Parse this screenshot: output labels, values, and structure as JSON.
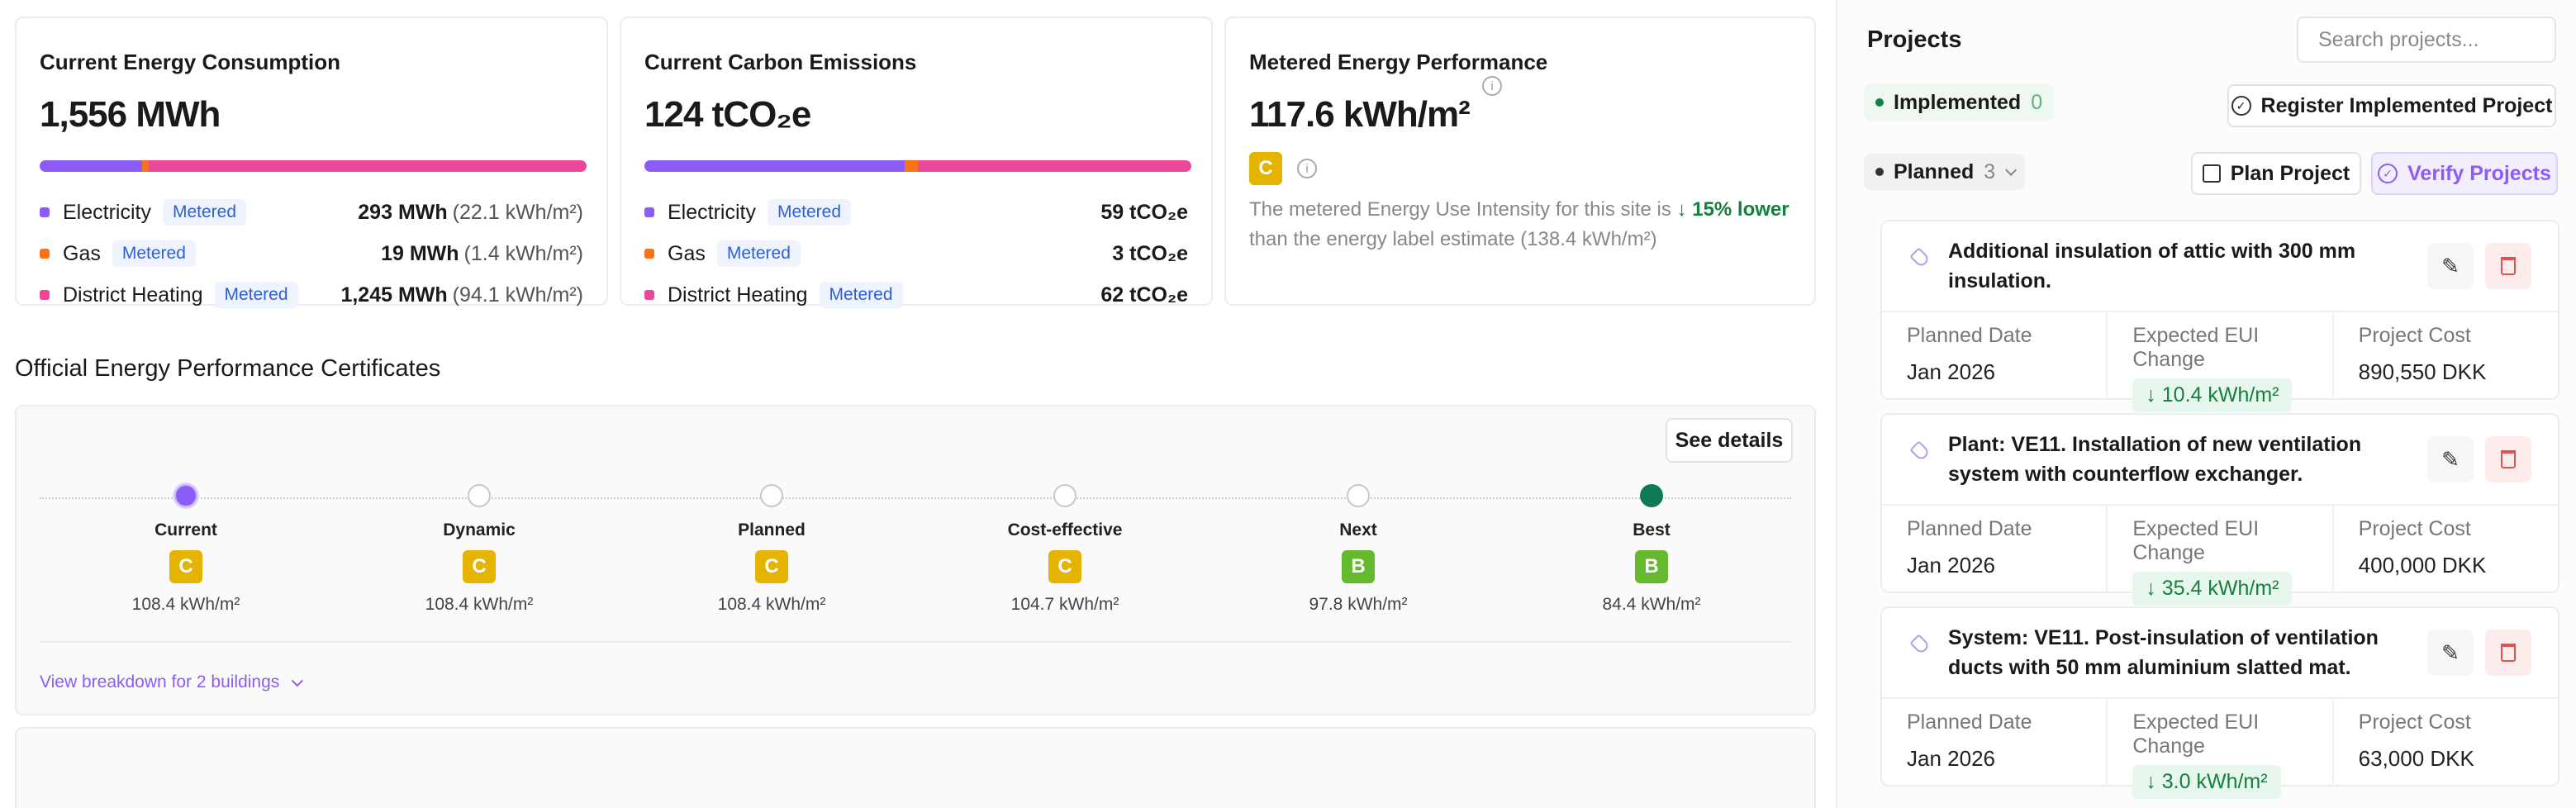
{
  "energy": {
    "title": "Current Energy Consumption",
    "value": "1,556 MWh",
    "bar": [
      {
        "fraction": 0.188,
        "color": "#8b5cf6"
      },
      {
        "fraction": 0.012,
        "color": "#f97316"
      },
      {
        "fraction": 0.8,
        "color": "#ec4899"
      }
    ],
    "rows": [
      {
        "label": "Electricity",
        "badge": "Metered",
        "value": "293 MWh",
        "sub": "(22.1 kWh/m²)",
        "color": "#8b5cf6"
      },
      {
        "label": "Gas",
        "badge": "Metered",
        "value": "19 MWh",
        "sub": "(1.4 kWh/m²)",
        "color": "#f97316"
      },
      {
        "label": "District Heating",
        "badge": "Metered",
        "value": "1,245 MWh",
        "sub": "(94.1 kWh/m²)",
        "color": "#ec4899"
      }
    ]
  },
  "carbon": {
    "title": "Current Carbon Emissions",
    "value": "124 tCO₂e",
    "bar": [
      {
        "fraction": 0.476,
        "color": "#8b5cf6"
      },
      {
        "fraction": 0.024,
        "color": "#f97316"
      },
      {
        "fraction": 0.5,
        "color": "#ec4899"
      }
    ],
    "rows": [
      {
        "label": "Electricity",
        "badge": "Metered",
        "value": "59 tCO₂e",
        "color": "#8b5cf6"
      },
      {
        "label": "Gas",
        "badge": "Metered",
        "value": "3 tCO₂e",
        "color": "#f97316"
      },
      {
        "label": "District Heating",
        "badge": "Metered",
        "value": "62 tCO₂e",
        "color": "#ec4899"
      }
    ]
  },
  "metered": {
    "title": "Metered Energy Performance",
    "value": "117.6 kWh/m²",
    "label": "C",
    "label_color": "#e4b400",
    "text_before": "The metered Energy Use Intensity for this site is",
    "highlight": "↓ 15% lower",
    "text_after": "than the energy label estimate (138.4 kWh/m²)"
  },
  "epc": {
    "title": "Official Energy Performance Certificates",
    "see_details": "See details",
    "stages": [
      {
        "name": "Current",
        "label": "C",
        "eui": "108.4 kWh/m²",
        "label_color": "#e4b400",
        "dot": "current"
      },
      {
        "name": "Dynamic",
        "label": "C",
        "eui": "108.4 kWh/m²",
        "label_color": "#e4b400",
        "dot": "empty"
      },
      {
        "name": "Planned",
        "label": "C",
        "eui": "108.4 kWh/m²",
        "label_color": "#e4b400",
        "dot": "empty"
      },
      {
        "name": "Cost-effective",
        "label": "C",
        "eui": "104.7 kWh/m²",
        "label_color": "#e4b400",
        "dot": "empty"
      },
      {
        "name": "Next",
        "label": "B",
        "eui": "97.8 kWh/m²",
        "label_color": "#65b92c",
        "dot": "empty"
      },
      {
        "name": "Best",
        "label": "B",
        "eui": "84.4 kWh/m²",
        "label_color": "#65b92c",
        "dot": "best"
      }
    ],
    "breakdown_link": "View breakdown for 2 buildings"
  },
  "projects": {
    "title": "Projects",
    "search_placeholder": "Search projects...",
    "implemented_label": "Implemented",
    "implemented_count": "0",
    "register_button": "Register Implemented Project",
    "planned_label": "Planned",
    "planned_count": "3",
    "plan_button": "Plan Project",
    "verify_button": "Verify Projects",
    "columns": {
      "date": "Planned Date",
      "eui": "Expected EUI Change",
      "cost": "Project Cost"
    },
    "items": [
      {
        "name": "Additional insulation of attic with 300 mm insulation.",
        "date": "Jan 2026",
        "eui": "↓ 10.4 kWh/m²",
        "cost": "890,550 DKK"
      },
      {
        "name": "Plant: VE11. Installation of new ventilation system with counterflow exchanger.",
        "date": "Jan 2026",
        "eui": "↓ 35.4 kWh/m²",
        "cost": "400,000 DKK"
      },
      {
        "name": "System: VE11. Post-insulation of ventilation ducts with 50 mm aluminium slatted mat.",
        "date": "Jan 2026",
        "eui": "↓ 3.0 kWh/m²",
        "cost": "63,000 DKK"
      }
    ]
  }
}
